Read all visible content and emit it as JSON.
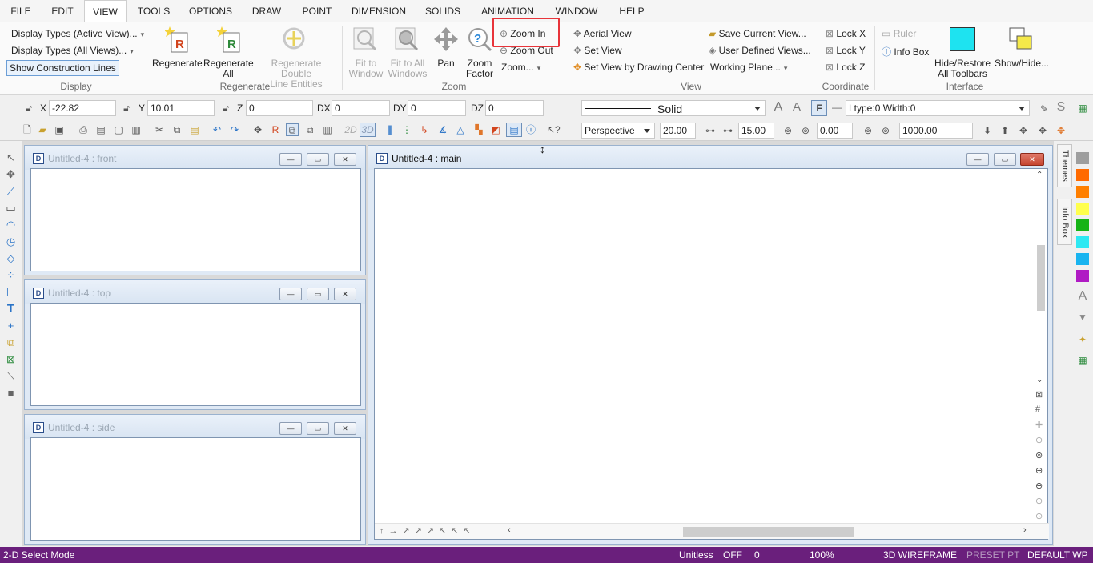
{
  "menu": {
    "items": [
      "FILE",
      "EDIT",
      "VIEW",
      "TOOLS",
      "OPTIONS",
      "DRAW",
      "POINT",
      "DIMENSION",
      "SOLIDS",
      "ANIMATION",
      "WINDOW",
      "HELP"
    ],
    "active": "VIEW"
  },
  "ribbon": {
    "display": {
      "types_active": "Display Types (Active View)...",
      "types_all": "Display Types (All Views)...",
      "show_construction": "Show Construction Lines",
      "group": "Display"
    },
    "regenerate": {
      "regenerate": "Regenerate",
      "regenerate_all_1": "Regenerate",
      "regenerate_all_2": "All",
      "regen_double_1": "Regenerate Double",
      "regen_double_2": "Line Entities",
      "group": "Regenerate"
    },
    "zoom": {
      "fit_window_1": "Fit to",
      "fit_window_2": "Window",
      "fit_all_1": "Fit to All",
      "fit_all_2": "Windows",
      "pan": "Pan",
      "zoom_factor_1": "Zoom",
      "zoom_factor_2": "Factor",
      "zoom_in": "Zoom In",
      "zoom_out": "Zoom Out",
      "zoom_menu": "Zoom...",
      "group": "Zoom"
    },
    "view": {
      "aerial": "Aerial View",
      "set_view": "Set View",
      "set_view_center": "Set View by Drawing Center",
      "save_current": "Save Current View...",
      "user_defined": "User Defined Views...",
      "working_plane": "Working Plane...",
      "group": "View"
    },
    "coordinate": {
      "lock_x": "Lock X",
      "lock_y": "Lock Y",
      "lock_z": "Lock Z",
      "group": "Coordinate"
    },
    "interface": {
      "ruler": "Ruler",
      "info_box": "Info Box",
      "hide_restore_1": "Hide/Restore",
      "hide_restore_2": "All Toolbars",
      "show_hide": "Show/Hide...",
      "group": "Interface",
      "accent": "#1ee3f0"
    }
  },
  "coords": {
    "x_label": "X",
    "x": "-22.82",
    "y_label": "Y",
    "y": "10.01",
    "z_label": "Z",
    "z": "0",
    "dx_label": "DX",
    "dx": "0",
    "dy_label": "DY",
    "dy": "0",
    "dz_label": "DZ",
    "dz": "0"
  },
  "line": {
    "style": "Solid",
    "ltype": "Ltype:0  Width:0"
  },
  "toolbar2": {
    "label_2d": "2D",
    "label_3d": "3D",
    "projection": "Perspective",
    "v1": "20.00",
    "v2": "15.00",
    "v3": "0.00",
    "v4": "1000.00"
  },
  "windows": {
    "front": "Untitled-4 : front",
    "top": "Untitled-4 : top",
    "side": "Untitled-4 : side",
    "main": "Untitled-4 : main"
  },
  "side_tabs": {
    "themes": "Themes",
    "info_box": "Info Box"
  },
  "swatches": [
    "#9e9e9e",
    "#ff6a00",
    "#ff7f00",
    "#ffff4d",
    "#16b316",
    "#2ee8f2",
    "#19b4f0",
    "#b01bc4"
  ],
  "status": {
    "mode": "2-D Select Mode",
    "units": "Unitless",
    "snap": "OFF",
    "layer": "0",
    "zoom": "100%",
    "render": "3D WIREFRAME",
    "preset": "PRESET PT",
    "wp": "DEFAULT WP",
    "bar_color": "#6a1f7c"
  }
}
